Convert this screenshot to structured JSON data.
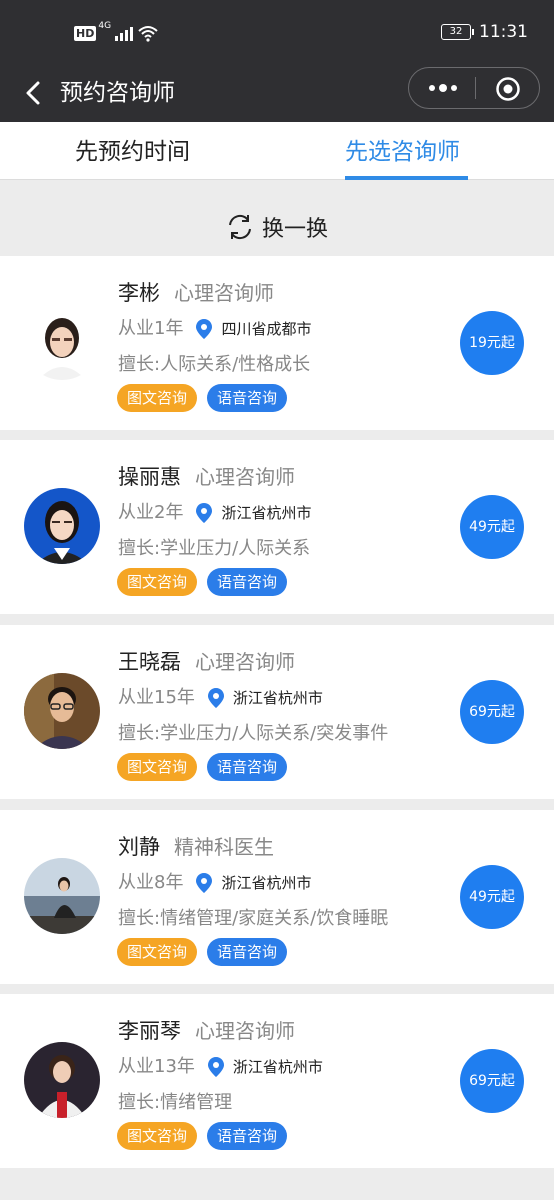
{
  "status_bar": {
    "network": "HD",
    "gen": "4G",
    "battery": "32",
    "time": "11:31"
  },
  "nav": {
    "title": "预约咨询师"
  },
  "tabs": [
    {
      "label": "先预约时间"
    },
    {
      "label": "先选咨询师"
    }
  ],
  "refresh": {
    "label": "换一换"
  },
  "consult_types": {
    "text": "图文咨询",
    "voice": "语音咨询"
  },
  "counselors": [
    {
      "name": "李彬",
      "role": "心理咨询师",
      "years": "从业1年",
      "location": "四川省成都市",
      "specialty": "擅长:人际关系/性格成长",
      "price": "19元起"
    },
    {
      "name": "操丽惠",
      "role": "心理咨询师",
      "years": "从业2年",
      "location": "浙江省杭州市",
      "specialty": "擅长:学业压力/人际关系",
      "price": "49元起"
    },
    {
      "name": "王晓磊",
      "role": "心理咨询师",
      "years": "从业15年",
      "location": "浙江省杭州市",
      "specialty": "擅长:学业压力/人际关系/突发事件",
      "price": "69元起"
    },
    {
      "name": "刘静",
      "role": "精神科医生",
      "years": "从业8年",
      "location": "浙江省杭州市",
      "specialty": "擅长:情绪管理/家庭关系/饮食睡眠",
      "price": "49元起"
    },
    {
      "name": "李丽琴",
      "role": "心理咨询师",
      "years": "从业13年",
      "location": "浙江省杭州市",
      "specialty": "擅长:情绪管理",
      "price": "69元起"
    }
  ],
  "colors": {
    "accent": "#2f8be6",
    "price_bg": "#1f7ef0",
    "text_badge": "#f5a524",
    "voice_badge": "#2b7de9"
  }
}
